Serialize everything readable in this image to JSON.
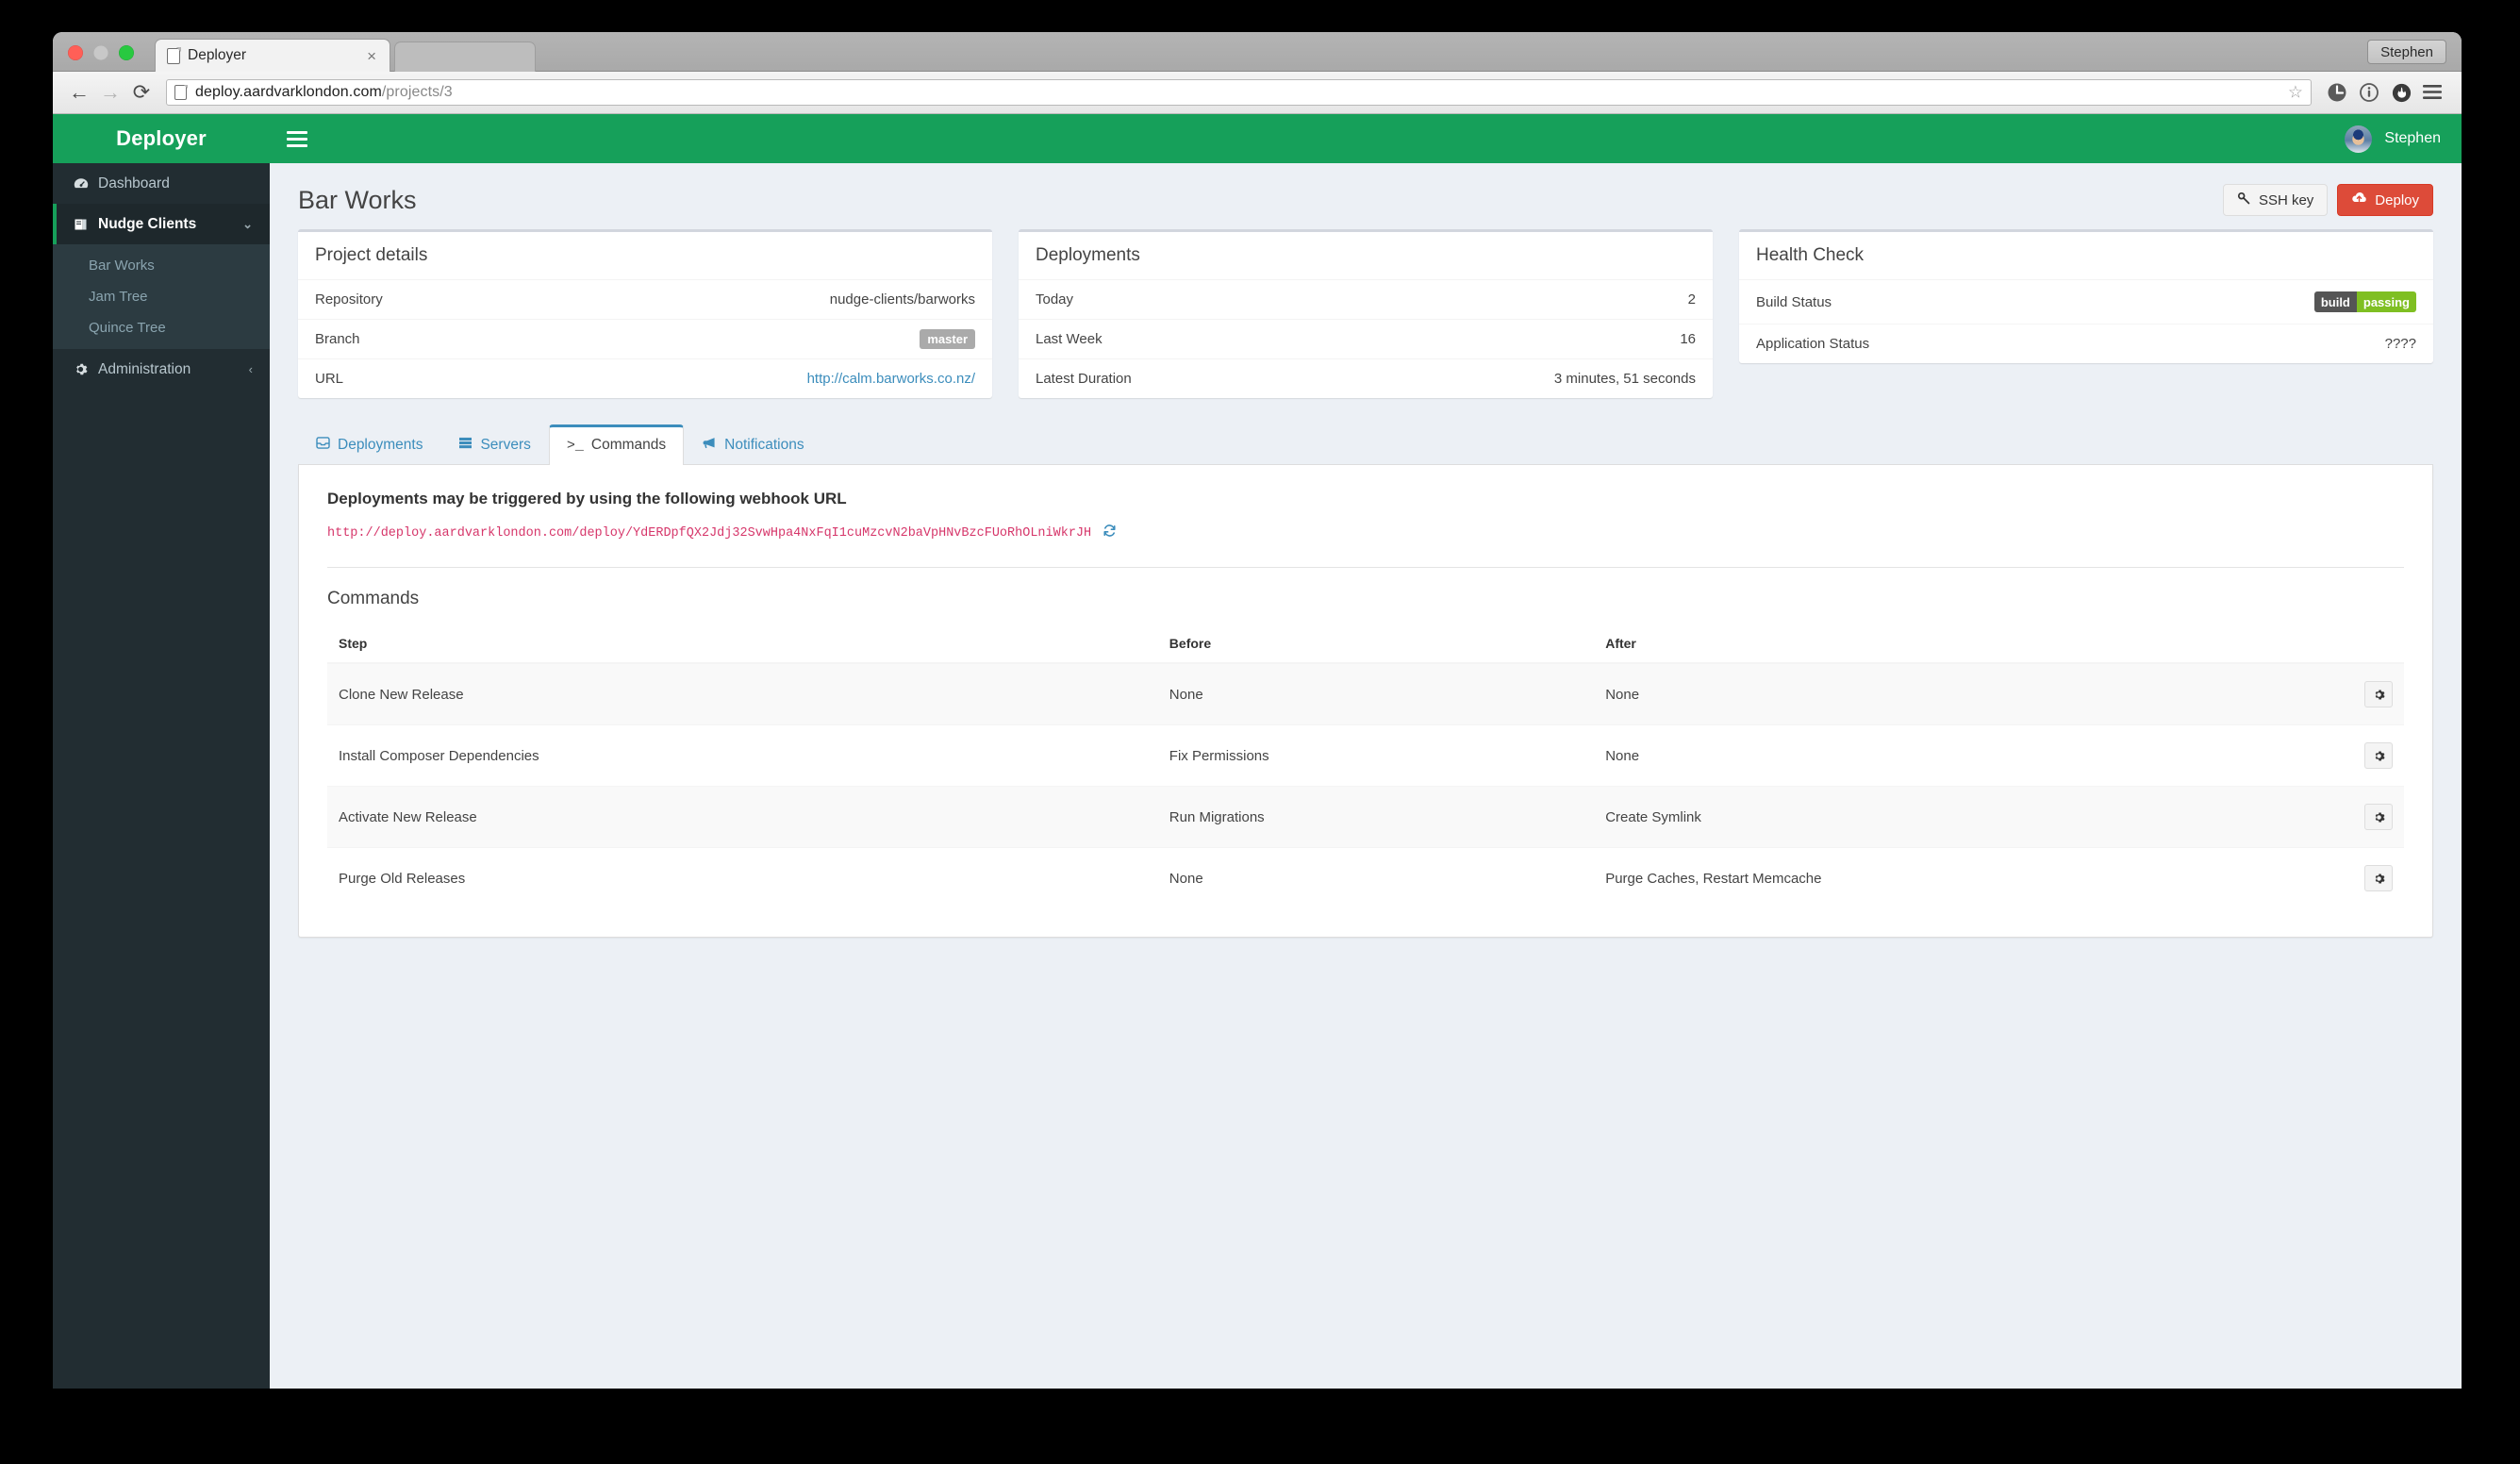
{
  "window": {
    "user_button": "Stephen",
    "tab": {
      "title": "Deployer",
      "close": "×",
      "favicon": "page-icon"
    },
    "toolbar": {
      "back": "←",
      "forward": "→",
      "reload": "⟳",
      "url_host": "deploy.aardvarklondon.com",
      "url_path": "/projects/3",
      "star": "☆",
      "icons": [
        "clock-icon",
        "info-icon",
        "flame-icon",
        "menu-icon"
      ]
    }
  },
  "sidebar": {
    "brand": "Deployer",
    "items": [
      {
        "label": "Dashboard",
        "icon": "dashboard-icon",
        "glyph": "◑",
        "active": false
      },
      {
        "label": "Nudge Clients",
        "icon": "book-icon",
        "glyph": "❏",
        "active": true,
        "caret": "⌄"
      }
    ],
    "sub_items": [
      {
        "label": "Bar Works"
      },
      {
        "label": "Jam Tree"
      },
      {
        "label": "Quince Tree"
      }
    ],
    "admin": {
      "label": "Administration",
      "icon": "gear-icon",
      "glyph": "✷",
      "caret": "‹"
    }
  },
  "navbar": {
    "toggle": "menu-toggle-icon",
    "user_name": "Stephen",
    "avatar": "user-avatar"
  },
  "header": {
    "title": "Bar Works",
    "ssh_key_button": "SSH key",
    "ssh_key_icon": "key-icon",
    "deploy_button": "Deploy",
    "deploy_icon": "cloud-upload-icon"
  },
  "panels": {
    "project_details": {
      "title": "Project details",
      "rows": [
        {
          "label": "Repository",
          "value": "nudge-clients/barworks",
          "type": "text"
        },
        {
          "label": "Branch",
          "value": "master",
          "type": "badge"
        },
        {
          "label": "URL",
          "value": "http://calm.barworks.co.nz/",
          "type": "link"
        }
      ]
    },
    "deployments": {
      "title": "Deployments",
      "rows": [
        {
          "label": "Today",
          "value": "2",
          "type": "text"
        },
        {
          "label": "Last Week",
          "value": "16",
          "type": "text"
        },
        {
          "label": "Latest Duration",
          "value": "3 minutes, 51 seconds",
          "type": "text"
        }
      ]
    },
    "health_check": {
      "title": "Health Check",
      "rows": [
        {
          "label": "Build Status",
          "type": "shield",
          "shield_left": "build",
          "shield_right": "passing"
        },
        {
          "label": "Application Status",
          "type": "ok",
          "value": "????"
        }
      ]
    }
  },
  "tabs": [
    {
      "label": "Deployments",
      "icon": "inbox-icon",
      "glyph": "▤",
      "active": false
    },
    {
      "label": "Servers",
      "icon": "server-icon",
      "glyph": "▤",
      "active": false
    },
    {
      "label": "Commands",
      "icon": "terminal-icon",
      "glyph": ">_",
      "active": true
    },
    {
      "label": "Notifications",
      "icon": "megaphone-icon",
      "glyph": "📢",
      "active": false
    }
  ],
  "webhook": {
    "title": "Deployments may be triggered by using the following webhook URL",
    "url": "http://deploy.aardvarklondon.com/deploy/YdERDpfQX2Jdj32SvwHpa4NxFqI1cuMzcvN2baVpHNvBzcFUoRhOLniWkrJH",
    "refresh_icon": "refresh-icon"
  },
  "commands": {
    "title": "Commands",
    "columns": [
      "Step",
      "Before",
      "After"
    ],
    "action_icon": "gear-icon",
    "rows": [
      {
        "step": "Clone New Release",
        "before": "None",
        "after": "None"
      },
      {
        "step": "Install Composer Dependencies",
        "before": "Fix Permissions",
        "after": "None"
      },
      {
        "step": "Activate New Release",
        "before": "Run Migrations",
        "after": "Create Symlink"
      },
      {
        "step": "Purge Old Releases",
        "before": "None",
        "after": "Purge Caches, Restart Memcache"
      }
    ]
  },
  "colors": {
    "brand_green": "#16a05a",
    "sidebar_dark": "#222d32",
    "sidebar_sub": "#2c3b41",
    "body_bg": "#ecf0f5",
    "danger_red": "#dd4b39",
    "link_blue": "#3c8dbc",
    "code_pink": "#d6366a",
    "badge_green": "#7fbf22",
    "ok_green": "#00a65a"
  }
}
